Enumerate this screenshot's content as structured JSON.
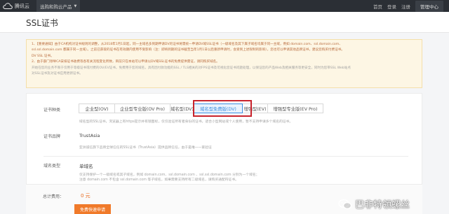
{
  "topbar": {
    "logo_text": "腾讯云",
    "product_menu": "选购和购云产品",
    "links": [
      "首页",
      "登录",
      "注册"
    ],
    "console": "管理中心"
  },
  "page": {
    "title": "SSL证书"
  },
  "notice": {
    "lines": [
      "1、【重要通知】由于CA机构对证书规则的调整，从2018年1月1日起，同一主域名多到期申请DV的证书将需统一申请DV域SSL证书（一级域名及其下属子域名均属于同一主域，例如 domain.com、ssl.domain.com、",
      "ssl.ssl.domain.com 都属于同一主域）。之前已获取的证书在有效期内使用不受影响（注：即将到期的证书截至当年1月1日以后重新申请时，会受到上述限制的影响），您也可以申请其他品牌证书，建议您购买付费证书。",
      "DV SSL 证书。",
      "2、由于部门领导CA安排证书收费等各有关流程变化所致，目前只在本站可以申请以DV域SSL证书的免费提供需证，请同购买域名。",
      "开始在您的业务不限于仅用于等级证书或付费的OV/EV证书，免费用于您的域名，具有因付款功能的SSL / TLS相关的对FPS证书及可视化您证书问题处理，以保证您的产品Web及相关服务等更安全，同时为您带SSL Web站点",
      "对SSL证书及对证书应用更新证书。"
    ]
  },
  "form": {
    "type_label": "证书种类",
    "tabs": [
      "企业型(OV)",
      "企业型专业版(OV Pro)",
      "域名型(DV)",
      "域名型免费版(DV)",
      "增强型(EV)",
      "增强型专业版(EV Pro)"
    ],
    "active_tab": "域名型免费版(DV)",
    "type_desc": "域名型的SSL证书，浏览器上有https提示并有锁图标，仅仅验证所有者身份的证书，适合小型网站或个人使用，暂不支持申请多个域名的证书。",
    "brand_label": "证书品牌",
    "brand_value": "TrustAsia",
    "brand_desc": "亚洲诚信旗下品牌全球信任的SSL证书（TrustAsia）提供品牌信任，由于是唯一一家验证",
    "domain_type_label": "域名类型",
    "domain_type_value": "单域名",
    "domain_desc_1": "仅支持保护一个一级域名或其子域名，例如 domain.com、ssl.domain.com 、ssl.ssl.domain.com 分别为一个域名；",
    "domain_desc_2": "注意 domain.com 不包含 ssl.domain.com 等子域名，如果需要支持所有二级域名，请购买通配符证书。"
  },
  "price": {
    "label": "总计费用：",
    "value": "0 元",
    "button": "免费快速申请"
  },
  "watermark": {
    "text": "巴非特领螺丝"
  },
  "colors": {
    "topbar_bg": "#2b2f35",
    "accent": "#3a8de0",
    "highlight": "#c8232c",
    "notice_text": "#b86a3c",
    "buy_button": "#f07a2a"
  }
}
